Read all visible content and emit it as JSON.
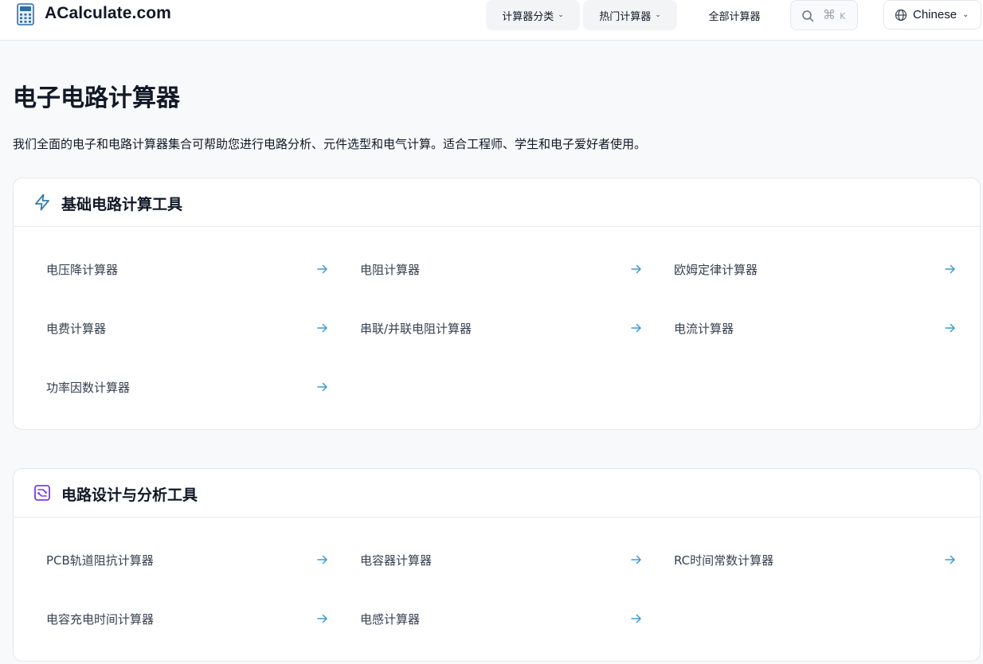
{
  "header": {
    "logo_text": "ACalculate.com",
    "nav_categories": "计算器分类",
    "nav_popular": "热门计算器",
    "nav_all": "全部计算器",
    "search_shortcut_symbol": "⌘",
    "search_shortcut_key": "K",
    "language": "Chinese"
  },
  "page": {
    "title": "电子电路计算器",
    "description": "我们全面的电子和电路计算器集合可帮助您进行电路分析、元件选型和电气计算。适合工程师、学生和电子爱好者使用。"
  },
  "sections": [
    {
      "title": "基础电路计算工具",
      "icon": "lightning-icon",
      "items": [
        "电压降计算器",
        "电阻计算器",
        "欧姆定律计算器",
        "电费计算器",
        "串联/并联电阻计算器",
        "电流计算器",
        "功率因数计算器"
      ]
    },
    {
      "title": "电路设计与分析工具",
      "icon": "circuit-board-icon",
      "items": [
        "PCB轨道阻抗计算器",
        "电容器计算器",
        "RC时间常数计算器",
        "电容充电时间计算器",
        "电感计算器"
      ]
    }
  ],
  "colors": {
    "accent_blue": "#3b82f6",
    "icon_blue": "#2f7fb5",
    "icon_purple": "#7c3aed",
    "arrow": "#3b9bd6"
  }
}
